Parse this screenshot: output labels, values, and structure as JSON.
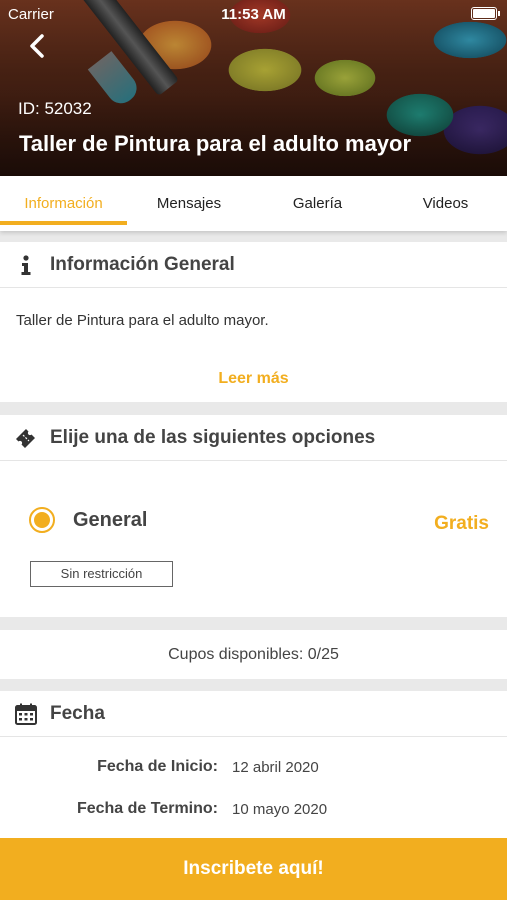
{
  "status_bar": {
    "carrier": "Carrier",
    "time": "11:53 AM"
  },
  "hero": {
    "id_label": "ID: 52032",
    "title": "Taller de Pintura para el adulto mayor"
  },
  "tabs": [
    {
      "label": "Información",
      "active": true
    },
    {
      "label": "Mensajes",
      "active": false
    },
    {
      "label": "Galería",
      "active": false
    },
    {
      "label": "Videos",
      "active": false
    }
  ],
  "info": {
    "header": "Información General",
    "icon": "info-icon",
    "description": "Taller de Pintura para el adulto mayor.",
    "read_more": "Leer más"
  },
  "options": {
    "header": "Elije una de las siguientes opciones",
    "icon": "ticket-icon",
    "items": [
      {
        "name": "General",
        "price": "Gratis",
        "restriction": "Sin restricción",
        "selected": true
      }
    ]
  },
  "availability": {
    "text": "Cupos disponibles: 0/25"
  },
  "dates": {
    "header": "Fecha",
    "icon": "calendar-icon",
    "start_label": "Fecha de Inicio:",
    "start_value": "12 abril 2020",
    "end_label": "Fecha de Termino:",
    "end_value": "10 mayo 2020"
  },
  "cta": {
    "label": "Inscribete aquí!"
  },
  "colors": {
    "accent": "#f2ae1f",
    "text": "#444444",
    "background": "#e9e9e9"
  }
}
